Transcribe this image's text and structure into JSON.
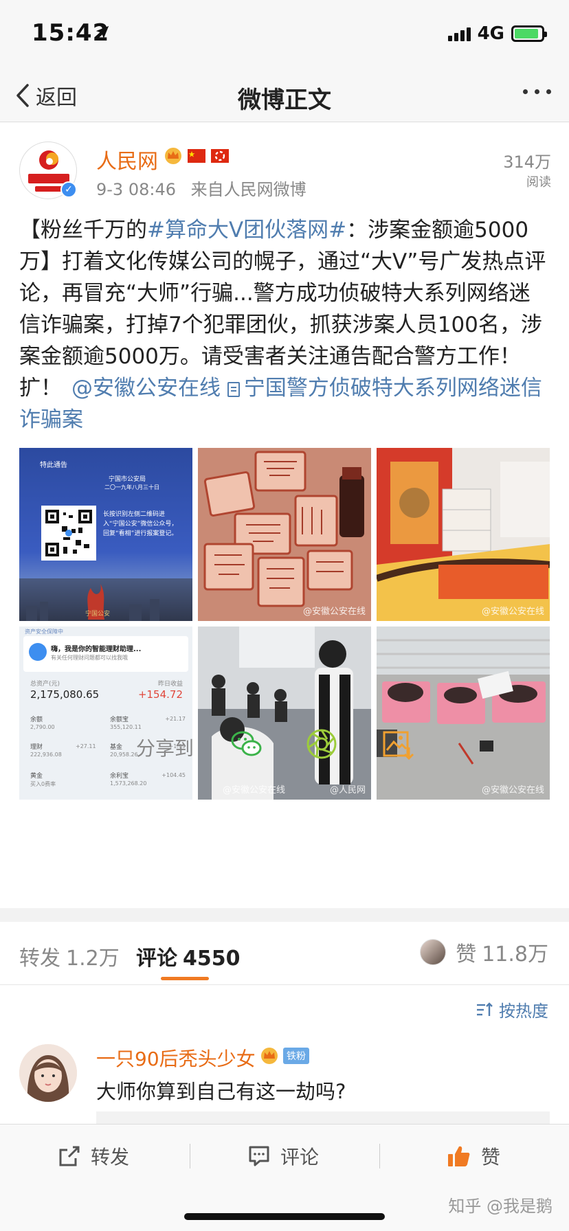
{
  "status_bar": {
    "time": "15:42",
    "network": "4G"
  },
  "nav": {
    "back_label": "返回",
    "title": "微博正文"
  },
  "post": {
    "author": "人民网",
    "time": "9-3 08:46",
    "source": "来自人民网微博",
    "reads_count": "314万",
    "reads_label": "阅读",
    "text": {
      "part1": "【粉丝千万的",
      "topic": "#算命大V团伙落网#",
      "part2": "：涉案金额逾5000万】打着文化传媒公司的幌子，通过“大V”号广发热点评论，再冒充“大师”行骗...警方成功侦破特大系列网络迷信诈骗案，打掉7个犯罪团伙，抓获涉案人员100名，涉案金额逾5000万。请受害者关注通告配合警方工作！扩！",
      "mention": "@安徽公安在线",
      "link": "宁国警方侦破特大系列网络迷信诈骗案"
    },
    "images": [
      {
        "caption": "特此通告",
        "org": "宁国市公安局",
        "date": "二〇一九年八月三十日",
        "instructions": "长按识别左侧二维码进入“宁国公安”微信公众号，回复“看相”进行报案登记。",
        "footer": "宁国公安"
      },
      {
        "watermark": "@安徽公安在线"
      },
      {
        "watermark": "@安徽公安在线"
      },
      {
        "header": "资产安全保障中",
        "greeting": "嗨，我是你的智能理财助理...",
        "subgreeting": "有关任何理财问题都可以找我哦",
        "total_label": "总资产(元)",
        "total": "2,175,080.65",
        "yesterday_label": "昨日收益",
        "yesterday": "+154.72",
        "row1_l_label": "余额",
        "row1_l": "2,790.00",
        "row1_r_label": "余额宝",
        "row1_r": "355,120.11",
        "row1_r_delta": "+21.17",
        "row2_l_label": "理财",
        "row2_l": "222,936.08",
        "row2_l_delta": "+27.11",
        "row2_r_label": "基金",
        "row2_r": "20,958.26",
        "row2_r_delta": "+1.99",
        "row3_l_label": "黄金",
        "row3_l": "买入0费率",
        "row3_r_label": "余利宝",
        "row3_r": "1,573,268.20",
        "row3_r_delta": "+104.45"
      },
      {
        "watermark": "@安徽公安在线",
        "watermark2": "@人民网"
      },
      {
        "watermark": "@安徽公安在线"
      }
    ]
  },
  "share": {
    "label": "分享到"
  },
  "tabs": {
    "repost_label": "转发",
    "repost_count": "1.2万",
    "comment_label": "评论",
    "comment_count": "4550",
    "like_label": "赞",
    "like_count": "11.8万"
  },
  "sort": {
    "label": "按热度"
  },
  "comment": {
    "author": "一只90后秃头少女",
    "fan_badge": "铁粉",
    "text": "大师你算到自己有这一劫吗?"
  },
  "toolbar": {
    "repost": "转发",
    "comment": "评论",
    "like": "赞"
  },
  "watermark": "知乎 @我是鹅",
  "colors": {
    "accent": "#f07a22",
    "link": "#507daf",
    "username": "#e86c16"
  }
}
